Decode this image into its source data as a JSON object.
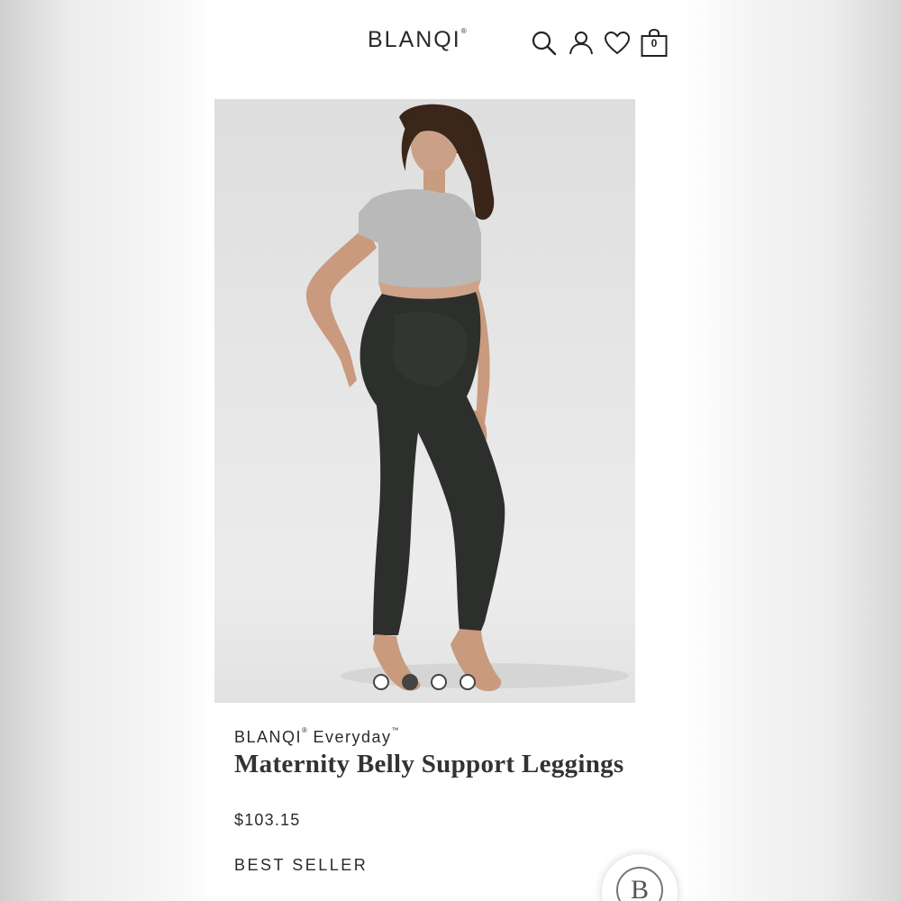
{
  "header": {
    "logo": "BLANQI",
    "logo_mark": "®",
    "icons": [
      "search-icon",
      "account-icon",
      "wishlist-heart-icon",
      "shopping-bag-icon"
    ],
    "cart_count": "0"
  },
  "gallery": {
    "image_alt": "Model wearing maternity belly support leggings",
    "slide_count": 4,
    "active_slide": 2
  },
  "product": {
    "brand": "BLANQI",
    "brand_mark": "®",
    "line": "Everyday",
    "line_mark": "™",
    "name": "Maternity Belly Support Leggings",
    "price": "$103.15",
    "badge": "BEST SELLER"
  },
  "floating_button": {
    "glyph": "B"
  },
  "colors": {
    "text": "#2b2b2b",
    "leggings": "#2c2f2b",
    "background": "#ffffff",
    "photo_bg": "#e4e4e4"
  }
}
